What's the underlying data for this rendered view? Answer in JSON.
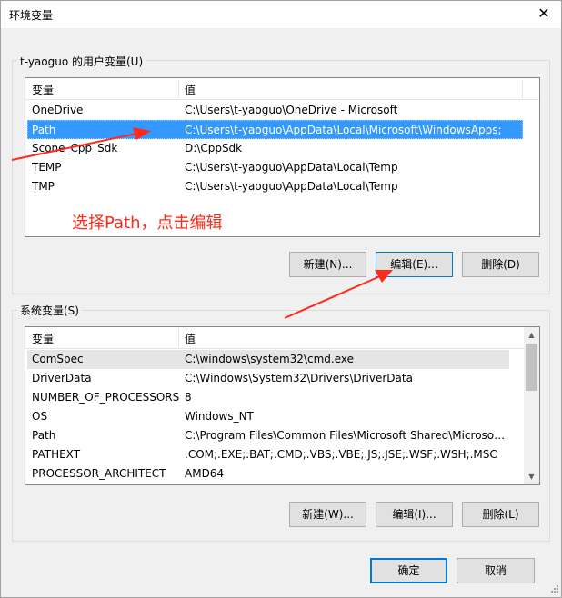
{
  "window": {
    "title": "环境变量",
    "close_symbol": "✕"
  },
  "user_vars": {
    "group_label": "t-yaoguo 的用户变量(U)",
    "columns": [
      "变量",
      "值"
    ],
    "rows": [
      {
        "name": "OneDrive",
        "value": "C:\\Users\\t-yaoguo\\OneDrive - Microsoft"
      },
      {
        "name": "Path",
        "value": "C:\\Users\\t-yaoguo\\AppData\\Local\\Microsoft\\WindowsApps;"
      },
      {
        "name": "Scone_Cpp_Sdk",
        "value": "D:\\CppSdk"
      },
      {
        "name": "TEMP",
        "value": "C:\\Users\\t-yaoguo\\AppData\\Local\\Temp"
      },
      {
        "name": "TMP",
        "value": "C:\\Users\\t-yaoguo\\AppData\\Local\\Temp"
      }
    ],
    "selected_index": 1,
    "buttons": {
      "new": "新建(N)...",
      "edit": "编辑(E)...",
      "delete": "删除(D)"
    }
  },
  "annotation": {
    "text": "选择Path，点击编辑",
    "color": "#ff2a1a"
  },
  "system_vars": {
    "group_label": "系统变量(S)",
    "columns": [
      "变量",
      "值"
    ],
    "rows": [
      {
        "name": "ComSpec",
        "value": "C:\\windows\\system32\\cmd.exe"
      },
      {
        "name": "DriverData",
        "value": "C:\\Windows\\System32\\Drivers\\DriverData"
      },
      {
        "name": "NUMBER_OF_PROCESSORS",
        "value": "8"
      },
      {
        "name": "OS",
        "value": "Windows_NT"
      },
      {
        "name": "Path",
        "value": "C:\\Program Files\\Common Files\\Microsoft Shared\\Microsoft ..."
      },
      {
        "name": "PATHEXT",
        "value": ".COM;.EXE;.BAT;.CMD;.VBS;.VBE;.JS;.JSE;.WSF;.WSH;.MSC"
      },
      {
        "name": "PROCESSOR_ARCHITECT",
        "value": "AMD64"
      }
    ],
    "buttons": {
      "new": "新建(W)...",
      "edit": "编辑(I)...",
      "delete": "删除(L)"
    }
  },
  "footer": {
    "ok": "确定",
    "cancel": "取消"
  }
}
